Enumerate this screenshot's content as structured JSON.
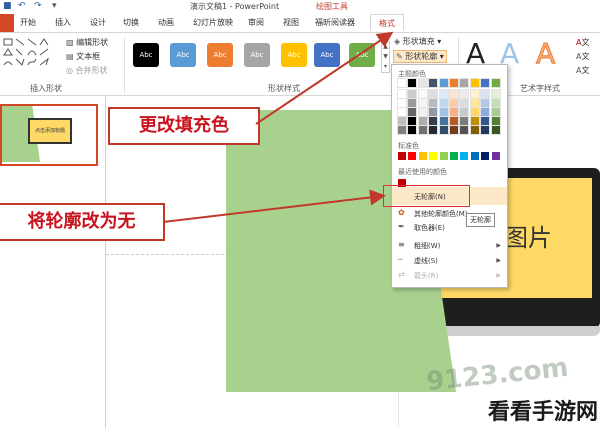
{
  "titlebar": {
    "title": "演示文稿1 - PowerPoint",
    "context_tab_group": "绘图工具"
  },
  "tabs": [
    "开始",
    "插入",
    "设计",
    "切换",
    "动画",
    "幻灯片放映",
    "审阅",
    "视图",
    "福昕阅读器",
    "格式"
  ],
  "ribbon": {
    "groups": {
      "insert_shapes": "插入形状",
      "shape_styles": "形状样式",
      "wordart_styles": "艺术字样式"
    },
    "edit_shape": "编辑形状",
    "text_box": "文本框",
    "merge_shapes": "合并形状",
    "shape_fill": "形状填充",
    "shape_outline": "形状轮廓",
    "swatch_text": "Abc",
    "swatch_colors": [
      "#000000",
      "#5b9bd5",
      "#ed7d31",
      "#a5a5a5",
      "#ffc000",
      "#4472c4",
      "#70ad47"
    ],
    "text_label_1": "文",
    "text_label_2": "文",
    "text_label_3": "文"
  },
  "dropdown": {
    "theme_colors_label": "主题颜色",
    "standard_colors_label": "标准色",
    "recent_colors_label": "最近使用的颜色",
    "no_outline": "无轮廓(N)",
    "more_colors": "其他轮廓颜色(M)...",
    "eyedropper": "取色器(E)",
    "weight": "粗细(W)",
    "dashes": "虚线(S)",
    "arrows": "箭头(R)",
    "tooltip": "无轮廓",
    "theme_colors": [
      "#ffffff",
      "#000000",
      "#e7e6e6",
      "#44546a",
      "#5b9bd5",
      "#ed7d31",
      "#a5a5a5",
      "#ffc000",
      "#4472c4",
      "#70ad47"
    ],
    "standard_colors": [
      "#c00000",
      "#ff0000",
      "#ffc000",
      "#ffff00",
      "#92d050",
      "#00b050",
      "#00b0f0",
      "#0070c0",
      "#002060",
      "#7030a0"
    ],
    "recent_color": "#c00000"
  },
  "annotations": {
    "fill": "更改填充色",
    "outline": "将轮廓改为无"
  },
  "slide": {
    "thumb_text": "点击添加标题",
    "picture_text": "画图片",
    "green": "#a9d18e",
    "yellow": "#ffd966"
  },
  "watermark": {
    "site": "9123.com",
    "brand": "看看手游网"
  }
}
